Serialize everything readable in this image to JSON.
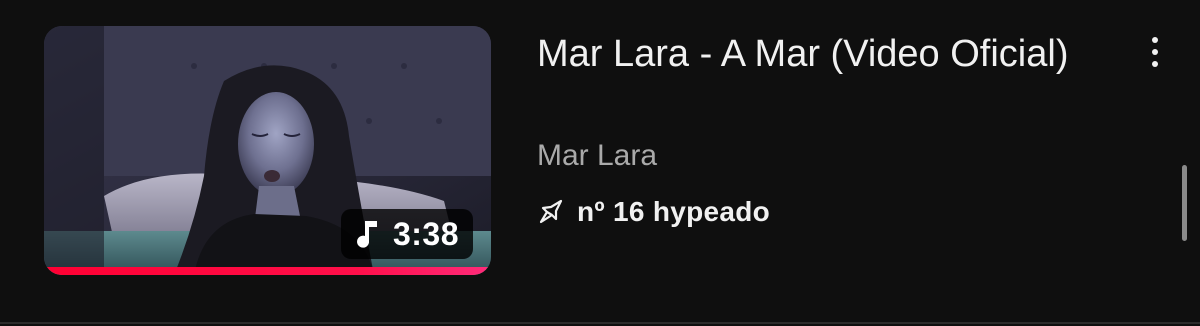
{
  "video": {
    "title": "Mar Lara - A Mar (Video Oficial)",
    "channel": "Mar Lara",
    "duration": "3:38",
    "hype_label": "nº 16 hypeado",
    "watch_progress": 1.0,
    "duration_icon": "music-note-icon",
    "hype_icon": "hype-rocket-icon",
    "menu_icon": "more-vertical-icon"
  },
  "colors": {
    "background": "#0f0f0f",
    "progress": "#ff0033",
    "title": "#f1f1f1",
    "channel": "#aaaaaa"
  }
}
